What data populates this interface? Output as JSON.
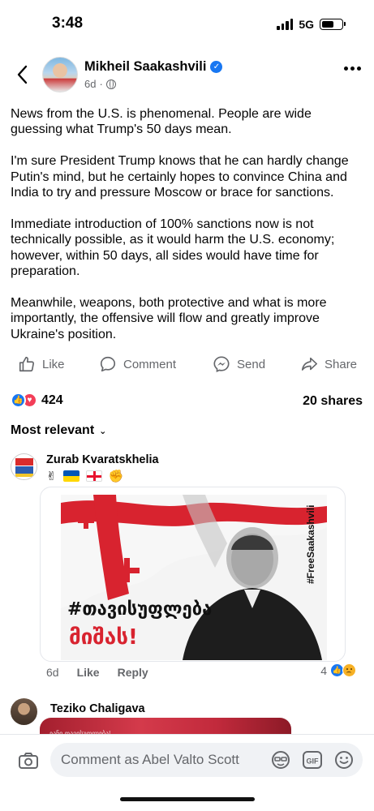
{
  "status_bar": {
    "time": "3:48",
    "network": "5G"
  },
  "post": {
    "author": "Mikheil Saakashvili",
    "time": "6d",
    "paragraphs": [
      "News from the U.S. is phenomenal. People are wide guessing what Trump's 50 days mean.",
      "I'm sure President Trump knows that he can hardly change Putin's mind, but he certainly hopes to convince China and India to try and pressure Moscow or brace for sanctions.",
      "Immediate introduction of 100% sanctions now is not technically possible, as it would harm the U.S. economy; however, within 50 days, all sides would have time for preparation.",
      "Meanwhile, weapons, both protective and what is more importantly, the offensive will flow and greatly improve Ukraine's position."
    ],
    "reaction_count": "424",
    "shares": "20 shares"
  },
  "actions": {
    "like": "Like",
    "comment": "Comment",
    "send": "Send",
    "share": "Share"
  },
  "comments_sort": "Most relevant",
  "comments": [
    {
      "author": "Zurab Kvaratskhelia",
      "image": {
        "hashtag_side": "#FreeSaakashvili",
        "slogan_line1": "#თავისუფლება",
        "slogan_line2": "მიშას!"
      },
      "time": "6d",
      "like_label": "Like",
      "reply_label": "Reply",
      "reaction_count": "4"
    },
    {
      "author": "Teziko Chaligava",
      "image_text": "ეანი თავისუფლება!"
    }
  ],
  "composer": {
    "placeholder": "Comment as Abel Valto Scott"
  },
  "colors": {
    "accent": "#1877f2",
    "love": "#f33e58",
    "flag_red": "#e8112d"
  }
}
